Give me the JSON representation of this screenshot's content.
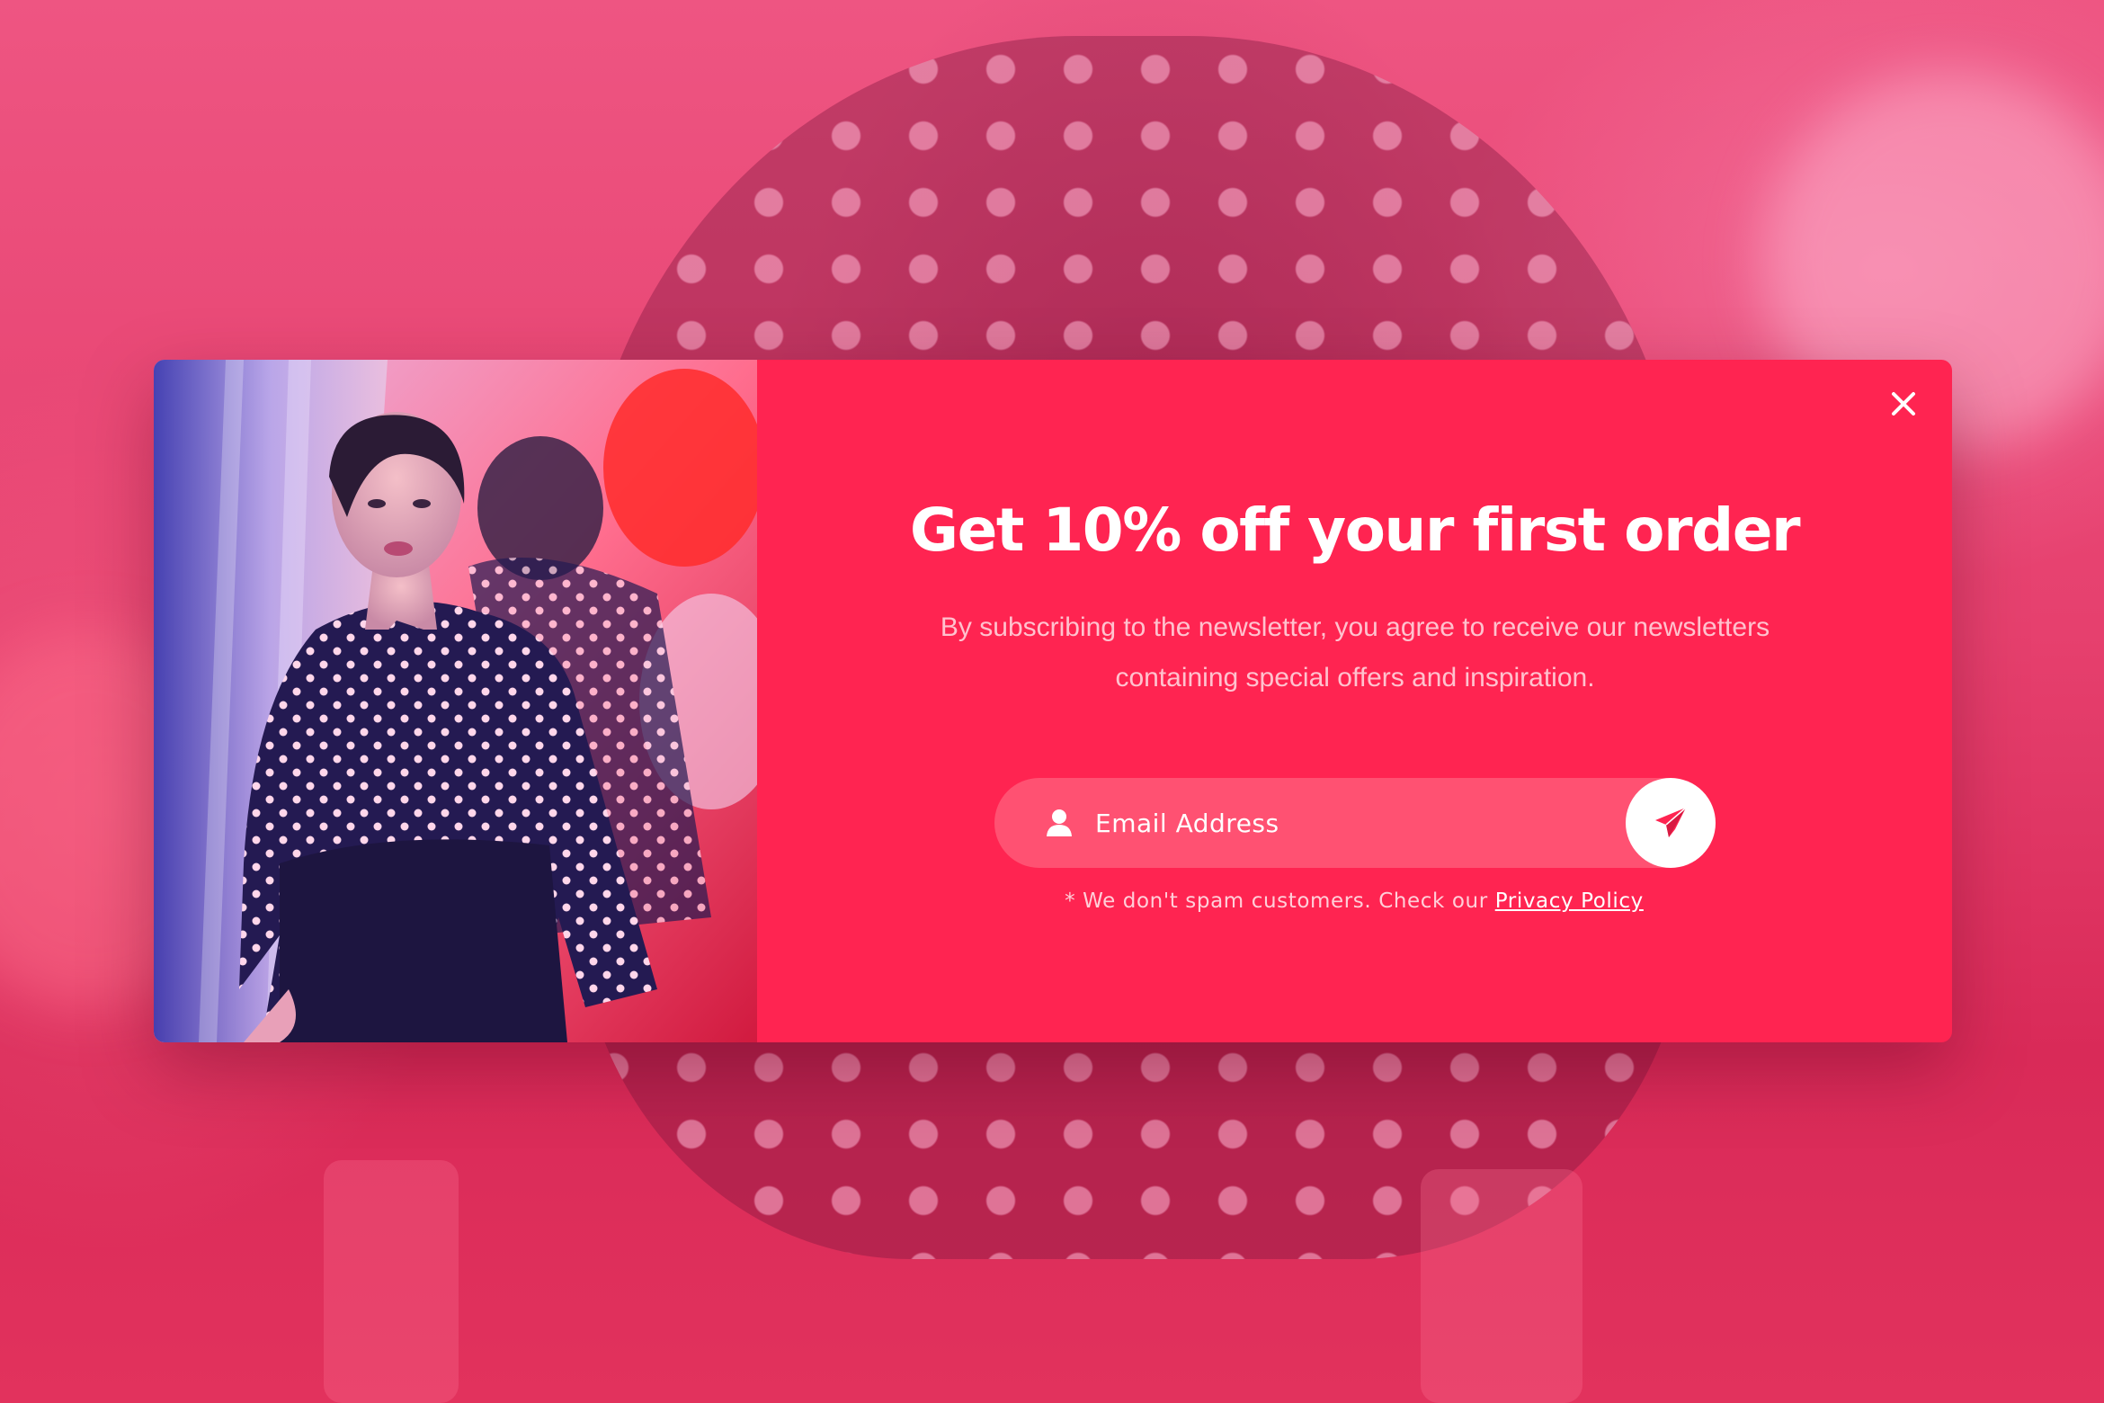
{
  "popup": {
    "headline": "Get 10% off your first order",
    "subtext_line1": "By subscribing to the newsletter, you agree to receive our newsletters",
    "subtext_line2": "containing special offers and inspiration.",
    "email_placeholder": "Email Address",
    "email_value": "",
    "disclaimer_text": "* We don't spam customers. Check our ",
    "privacy_link_label": "Privacy Policy"
  },
  "icons": {
    "close": "close-icon",
    "user": "user-icon",
    "submit": "paper-plane-icon"
  },
  "colors": {
    "modal_background": "#ff2451",
    "input_background": "#ff5172",
    "submit_button": "#ffffff",
    "submit_icon": "#ff2451",
    "page_background": "#e6406e"
  }
}
